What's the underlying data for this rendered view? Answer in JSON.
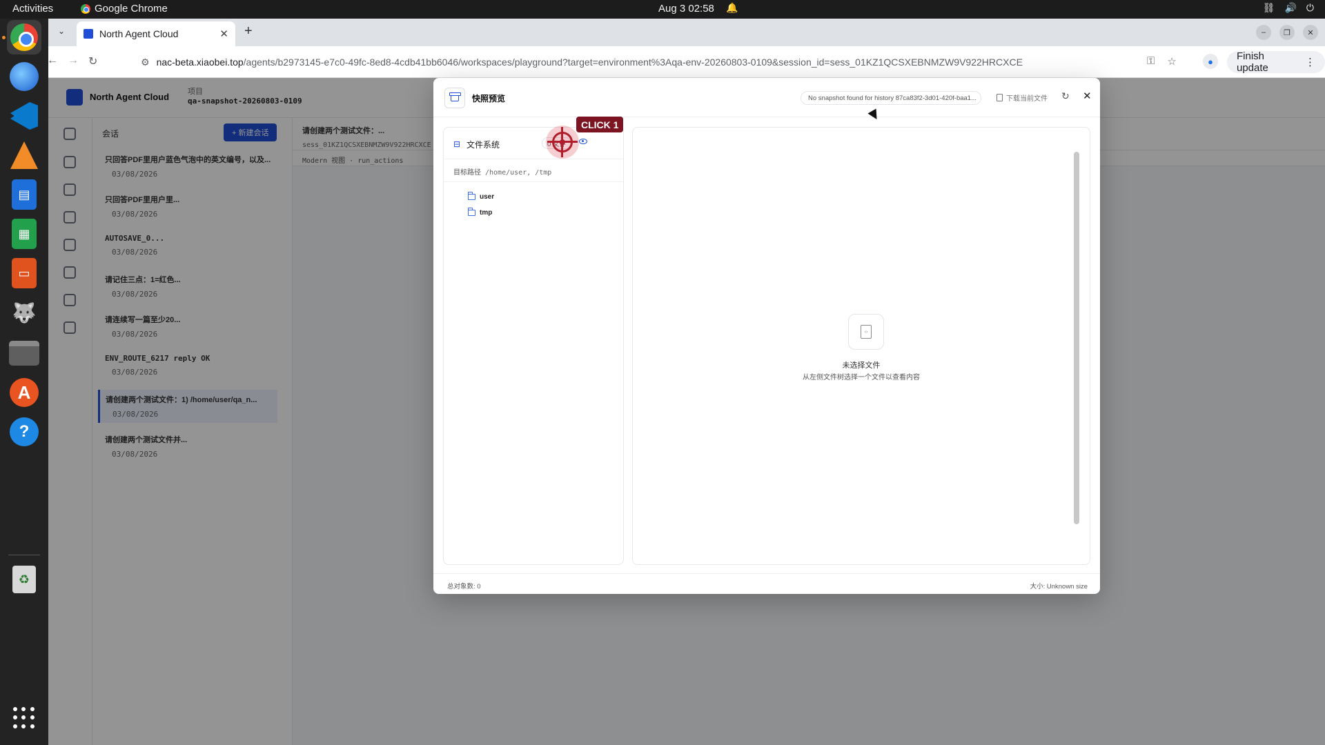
{
  "topbar": {
    "activities": "Activities",
    "app_name": "Google Chrome",
    "clock": "Aug 3  02:58"
  },
  "dock": {
    "items": [
      "chrome-icon",
      "thunderbird-icon",
      "vscode-icon",
      "vlc-icon",
      "writer-icon",
      "calc-icon",
      "impress-icon",
      "gimp-icon",
      "files-icon",
      "app-store-icon",
      "help-icon",
      "trash-icon"
    ]
  },
  "browser": {
    "tab_title": "North Agent Cloud",
    "url_host": "nac-beta.xiaobei.top",
    "url_path": "/agents/b2973145-e7c0-49fc-8ed8-4cdb41bb6046/workspaces/playground?target=environment%3Aqa-env-20260803-0109&session_id=sess_01KZ1QCSXEBNMZW9V922HRCXCE",
    "finish_update": "Finish update"
  },
  "app": {
    "brand": "North Agent Cloud",
    "project_label": "项目",
    "project_value": "qa-snapshot-20260803-0109",
    "sessions_title": "会话",
    "new_session": "+ 新建会话",
    "sessions": [
      {
        "title": "只回答PDF里用户蓝色气泡中的英文编号，以及...",
        "date": "03/08/2026"
      },
      {
        "title": "只回答PDF里用户里...",
        "date": "03/08/2026"
      },
      {
        "title": "AUTOSAVE_0...",
        "date": "03/08/2026"
      },
      {
        "title": "请记住三点：1=红色...",
        "date": "03/08/2026"
      },
      {
        "title": "请连续写一篇至少20...",
        "date": "03/08/2026"
      },
      {
        "title": "ENV_ROUTE_6217 reply OK",
        "date": "03/08/2026"
      },
      {
        "title": "请创建两个测试文件：1) /home/user/qa_n...",
        "date": "03/08/2026"
      },
      {
        "title": "请创建两个测试文件并...",
        "date": "03/08/2026"
      }
    ],
    "main_title": "请创建两个测试文件：...",
    "main_session": "sess_01KZ1QCSXEBNMZW9V922HRCXCE",
    "main_mode": "Modern 视图 · run_actions"
  },
  "modal": {
    "title": "快照预览",
    "status": "No snapshot found for history 87ca83f2-3d01-420f-baa1...",
    "download": "下载当前文件",
    "fs_title": "文件系统",
    "file_count": "0 文件",
    "target_label": "目标路径",
    "target_value": "/home/user, /tmp",
    "tree": [
      {
        "name": "user"
      },
      {
        "name": "tmp"
      }
    ],
    "empty_title": "未选择文件",
    "empty_subtitle": "从左侧文件树选择一个文件以查看内容",
    "total": "总对象数: 0",
    "size": "大小: Unknown size"
  },
  "annotation": {
    "click_label": "CLICK 1"
  },
  "colors": {
    "accent": "#1f4fd6",
    "marker": "#b01e2c",
    "marker_label_bg": "#7d1422"
  }
}
